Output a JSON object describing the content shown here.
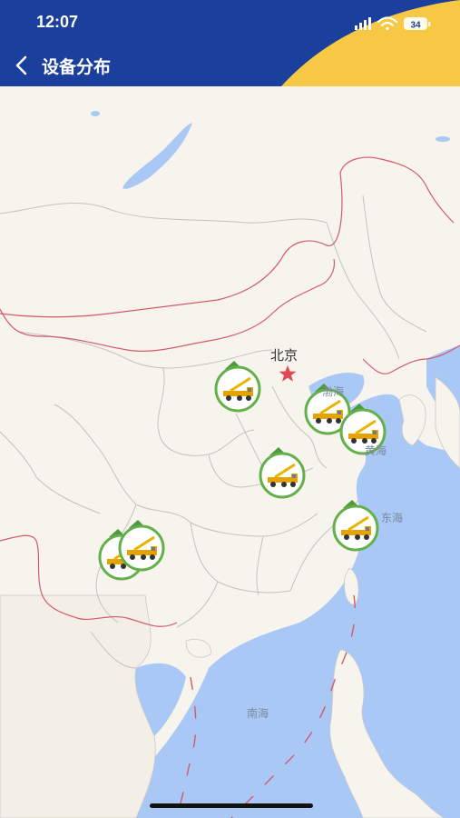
{
  "status_bar": {
    "time": "12:07",
    "battery": "34"
  },
  "nav": {
    "title": "设备分布",
    "back_icon": "chevron-left-icon"
  },
  "map": {
    "labels": {
      "beijing": "北京",
      "bohai": "渤海",
      "huanghai": "黄海",
      "donghai": "东海",
      "nanhai": "南海"
    },
    "capital_icon": "red-star-icon",
    "marker_icon": "crane-truck-icon",
    "marker_count": 7
  },
  "colors": {
    "header_blue": "#1b3f9c",
    "header_yellow": "#f6c844",
    "sea": "#a9c8f5",
    "land": "#f7f4ee",
    "marker_ring": "#63b04a",
    "border_red": "#d45a6a"
  }
}
